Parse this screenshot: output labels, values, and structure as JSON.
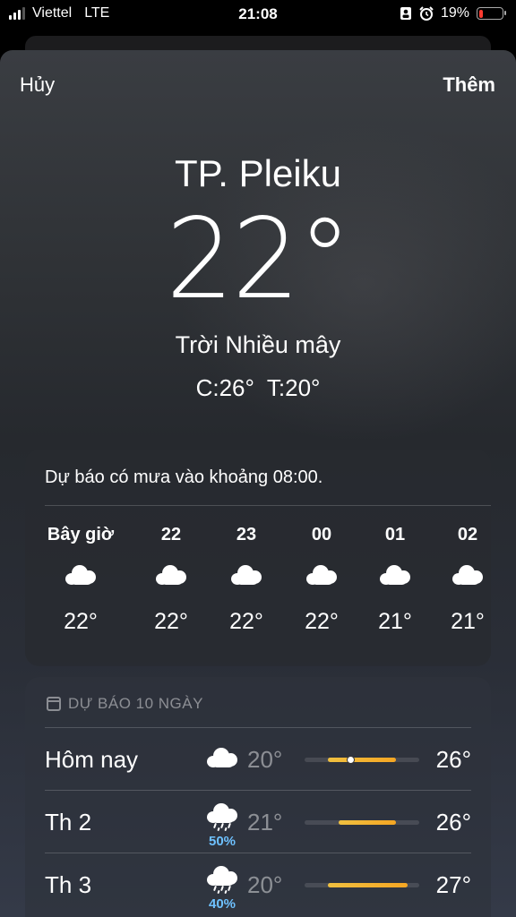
{
  "status_bar": {
    "carrier": "Viettel",
    "network": "LTE",
    "time": "21:08",
    "battery_percent": "19%",
    "battery_level": 0.19,
    "icons": [
      "signal-icon",
      "portrait-lock-icon",
      "alarm-icon",
      "battery-icon"
    ]
  },
  "nav": {
    "cancel_label": "Hủy",
    "add_label": "Thêm"
  },
  "current": {
    "city": "TP. Pleiku",
    "temperature": "22°",
    "condition": "Trời Nhiều mây",
    "high": "C:26°",
    "low": "T:20°"
  },
  "hourly": {
    "note": "Dự báo có mưa vào khoảng 08:00.",
    "items": [
      {
        "hour": "Bây giờ",
        "icon": "cloud-icon",
        "temp": "22°"
      },
      {
        "hour": "22",
        "icon": "cloud-icon",
        "temp": "22°"
      },
      {
        "hour": "23",
        "icon": "cloud-icon",
        "temp": "22°"
      },
      {
        "hour": "00",
        "icon": "cloud-icon",
        "temp": "22°"
      },
      {
        "hour": "01",
        "icon": "cloud-icon",
        "temp": "21°"
      },
      {
        "hour": "02",
        "icon": "cloud-icon",
        "temp": "21°"
      }
    ]
  },
  "daily": {
    "header": "DỰ BÁO 10 NGÀY",
    "range_min": 18,
    "range_max": 28,
    "rows": [
      {
        "day": "Hôm nay",
        "icon": "cloud-icon",
        "precip": "",
        "low": "20°",
        "high": "26°",
        "low_value": 20,
        "high_value": 26,
        "current_value": 22
      },
      {
        "day": "Th 2",
        "icon": "cloud-rain-icon",
        "precip": "50%",
        "low": "21°",
        "high": "26°",
        "low_value": 21,
        "high_value": 26
      },
      {
        "day": "Th 3",
        "icon": "cloud-rain-icon",
        "precip": "40%",
        "low": "20°",
        "high": "27°",
        "low_value": 20,
        "high_value": 27
      }
    ]
  },
  "colors": {
    "precip": "#6ec1ff",
    "battery_low": "#ff3b30",
    "temp_bar": "#f5a623"
  }
}
